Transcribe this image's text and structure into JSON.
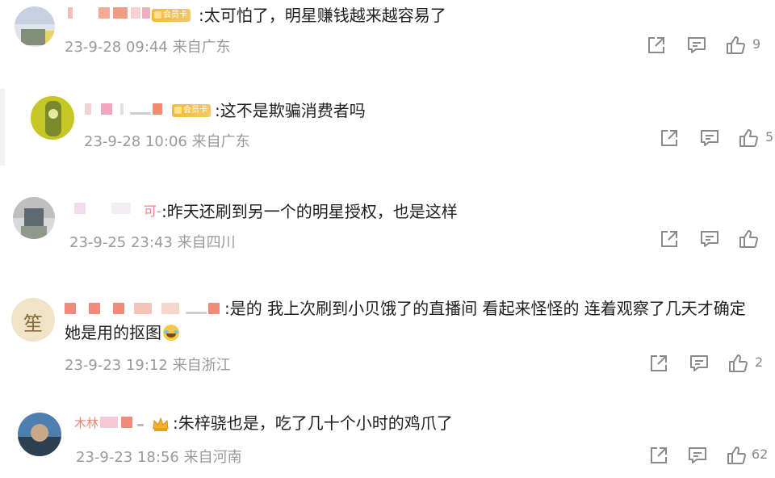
{
  "comments": [
    {
      "text": ":太可怕了，明星赚钱越来越容易了",
      "time": "23-9-28 09:44 来自广东",
      "likes": "9",
      "badge": "会员卡"
    },
    {
      "text": ":这不是欺骗消费者吗",
      "time": "23-9-28 10:06 来自广东",
      "likes": "5",
      "badge": "会员卡"
    },
    {
      "text_prefix": "可-",
      "text": ":昨天还刷到另一个的明星授权，也是这样",
      "time": "23-9-25 23:43 来自四川",
      "likes": ""
    },
    {
      "text": ":是的 我上次刷到小贝饿了的直播间 看起来怪怪的 连着观察了几天才确定",
      "text_line2": "她是用的抠图",
      "time": "23-9-23 19:12 来自浙江",
      "likes": "2",
      "avatar_label": "笙"
    },
    {
      "text": ":朱梓骁也是，吃了几十个小时的鸡爪了",
      "time": "23-9-23 18:56 来自河南",
      "likes": "62",
      "name_prefix": "木林"
    }
  ],
  "icons": {
    "share": "share-icon",
    "comment": "comment-icon",
    "like": "thumbs-up-icon",
    "laugh": "laughing-emoji-icon",
    "crown": "crown-icon"
  },
  "colors": {
    "text": "#1f1f1f",
    "meta": "#9a9a9a",
    "icon": "#8a8a8a",
    "badge": "#f5b93a"
  }
}
